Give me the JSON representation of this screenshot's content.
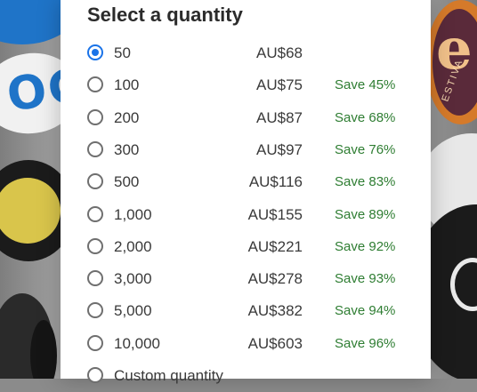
{
  "dialog": {
    "title": "Select a quantity",
    "selected_index": 0,
    "options": [
      {
        "quantity": "50",
        "price": "AU$68",
        "savings": ""
      },
      {
        "quantity": "100",
        "price": "AU$75",
        "savings": "Save 45%"
      },
      {
        "quantity": "200",
        "price": "AU$87",
        "savings": "Save 68%"
      },
      {
        "quantity": "300",
        "price": "AU$97",
        "savings": "Save 76%"
      },
      {
        "quantity": "500",
        "price": "AU$116",
        "savings": "Save 83%"
      },
      {
        "quantity": "1,000",
        "price": "AU$155",
        "savings": "Save 89%"
      },
      {
        "quantity": "2,000",
        "price": "AU$221",
        "savings": "Save 92%"
      },
      {
        "quantity": "3,000",
        "price": "AU$278",
        "savings": "Save 93%"
      },
      {
        "quantity": "5,000",
        "price": "AU$382",
        "savings": "Save 94%"
      },
      {
        "quantity": "10,000",
        "price": "AU$603",
        "savings": "Save 96%"
      },
      {
        "quantity": "Custom quantity",
        "price": "",
        "savings": ""
      }
    ]
  },
  "background": {
    "left_sticker_text": "OC",
    "right_sticker_letter": "e",
    "right_sticker_text": "ESTIVA"
  },
  "colors": {
    "radio_selected": "#1a73e8",
    "savings_text": "#2e7d32",
    "title_text": "#2b2b2b"
  }
}
